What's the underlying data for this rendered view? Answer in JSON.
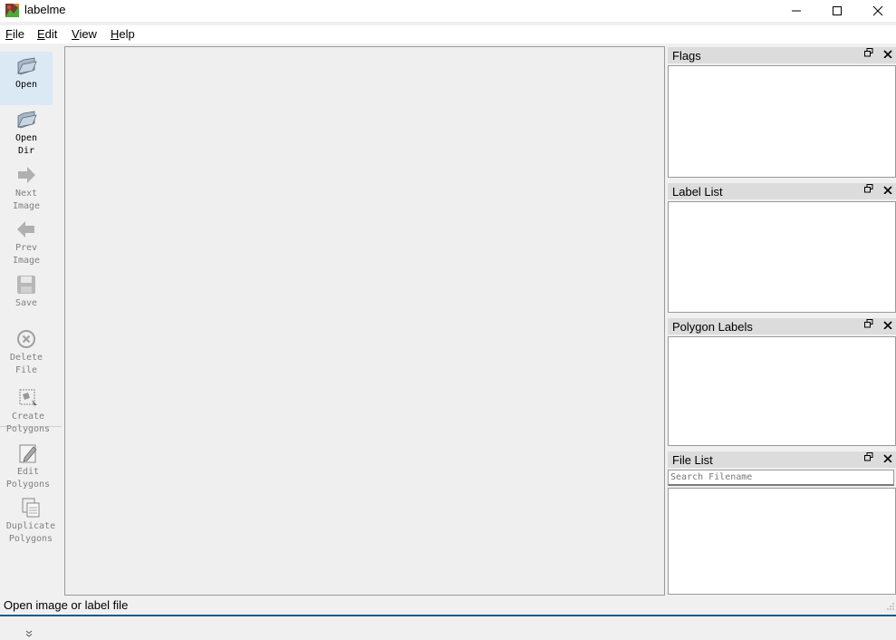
{
  "window": {
    "title": "labelme",
    "icon": "labelme-app-icon",
    "controls": {
      "minimize": "—",
      "maximize": "☐",
      "close": "✕"
    }
  },
  "menu": {
    "file": {
      "mnemonic": "F",
      "rest": "ile"
    },
    "edit": {
      "mnemonic": "E",
      "rest": "dit"
    },
    "view": {
      "mnemonic": "V",
      "rest": "iew"
    },
    "help": {
      "mnemonic": "H",
      "rest": "elp"
    }
  },
  "toolbar": {
    "open": {
      "line1": "Open",
      "icon": "folder-open-icon"
    },
    "open_dir": {
      "line1": "Open",
      "line2": "Dir",
      "icon": "folder-open-icon"
    },
    "next_image": {
      "line1": "Next",
      "line2": "Image",
      "icon": "arrow-right-icon"
    },
    "prev_image": {
      "line1": "Prev",
      "line2": "Image",
      "icon": "arrow-left-icon"
    },
    "save": {
      "line1": "Save",
      "icon": "floppy-icon"
    },
    "delete_file": {
      "line1": "Delete",
      "line2": "File",
      "icon": "circle-x-icon"
    },
    "create_polygons": {
      "line1": "Create",
      "line2": "Polygons",
      "icon": "create-polygon-icon"
    },
    "edit_polygons": {
      "line1": "Edit",
      "line2": "Polygons",
      "icon": "edit-polygon-icon"
    },
    "duplicate_polygons": {
      "line1": "Duplicate",
      "line2": "Polygons",
      "icon": "duplicate-icon"
    },
    "more": "»"
  },
  "docks": {
    "flags": {
      "title": "Flags"
    },
    "label_list": {
      "title": "Label List"
    },
    "polygon_labels": {
      "title": "Polygon Labels"
    },
    "file_list": {
      "title": "File List",
      "search_placeholder": "Search Filename"
    },
    "float_glyph": "🗗",
    "close_glyph": "✕"
  },
  "status": {
    "text": "Open image or label file",
    "grip": "⋰"
  },
  "colors": {
    "accent_bottom": "#1e5a8a",
    "active_tool": "#dbe9f5"
  }
}
